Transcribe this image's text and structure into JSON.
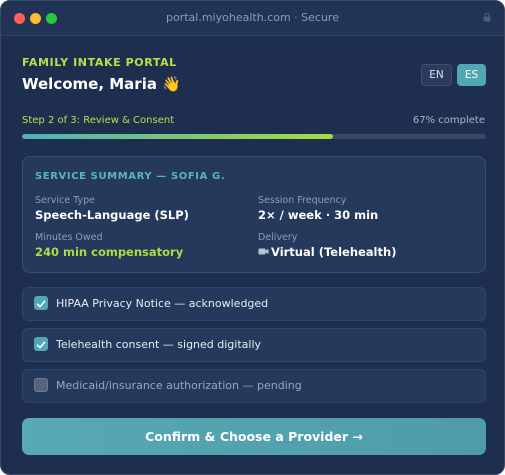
{
  "browser": {
    "url": "portal.miyohealth.com · Secure"
  },
  "header": {
    "brand": "FAMILY INTAKE PORTAL",
    "welcome": "Welcome, Maria 👋",
    "languages": [
      "EN",
      "ES"
    ],
    "active_language": "ES"
  },
  "progress": {
    "step_label": "Step 2 of 3: Review & Consent",
    "percent_label": "67% complete",
    "percent": 67
  },
  "summary": {
    "title": "SERVICE SUMMARY — SOFIA G.",
    "service_type_label": "Service Type",
    "service_type": "Speech-Language (SLP)",
    "frequency_label": "Session Frequency",
    "frequency": "2× / week · 30 min",
    "minutes_owed_label": "Minutes Owed",
    "minutes_owed": "240 min compensatory",
    "delivery_label": "Delivery",
    "delivery": "Virtual (Telehealth)"
  },
  "consents": [
    {
      "label": "HIPAA Privacy Notice — acknowledged",
      "checked": true
    },
    {
      "label": "Telehealth consent — signed digitally",
      "checked": true
    },
    {
      "label": "Medicaid/insurance authorization — pending",
      "checked": false
    }
  ],
  "actions": {
    "confirm_label": "Confirm & Choose a Provider →"
  },
  "colors": {
    "background": "#1d2e4f",
    "accent_green": "#b7e04a",
    "accent_teal": "#4fa8b4"
  }
}
